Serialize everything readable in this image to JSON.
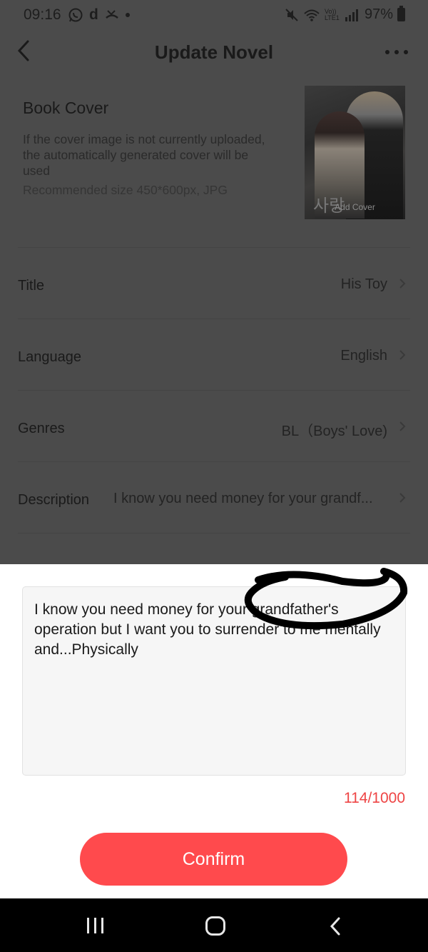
{
  "status_bar": {
    "time": "09:16",
    "left_icons": [
      "whatsapp-icon",
      "d-app-icon",
      "missed-call-icon",
      "dot-icon"
    ],
    "right_icons": [
      "mute-icon",
      "wifi-icon",
      "volte-icon",
      "signal-icon"
    ],
    "volte_label": "Vo)) LTE1",
    "battery_percent": "97%"
  },
  "header": {
    "title": "Update Novel"
  },
  "cover": {
    "heading": "Book Cover",
    "description": "If the cover image is not currently uploaded, the automatically generated cover will be used",
    "recommendation": "Recommended size 450*600px, JPG",
    "add_cover_label": "Add Cover",
    "image_text": "사랑"
  },
  "fields": {
    "title": {
      "label": "Title",
      "value": "His Toy"
    },
    "language": {
      "label": "Language",
      "value": "English"
    },
    "genres": {
      "label": "Genres",
      "value": "BL（Boys' Love)"
    },
    "description": {
      "label": "Description",
      "value": "I know you need money for your grandf..."
    }
  },
  "sheet": {
    "description_text": "I know you need money for your grandfather's operation but I want you to surrender to me mentally and...Physically",
    "char_count": "114/1000",
    "confirm_label": "Confirm"
  },
  "colors": {
    "accent": "#ff4a4d",
    "counter": "#ee4444",
    "overlay": "#4b4b4b"
  }
}
